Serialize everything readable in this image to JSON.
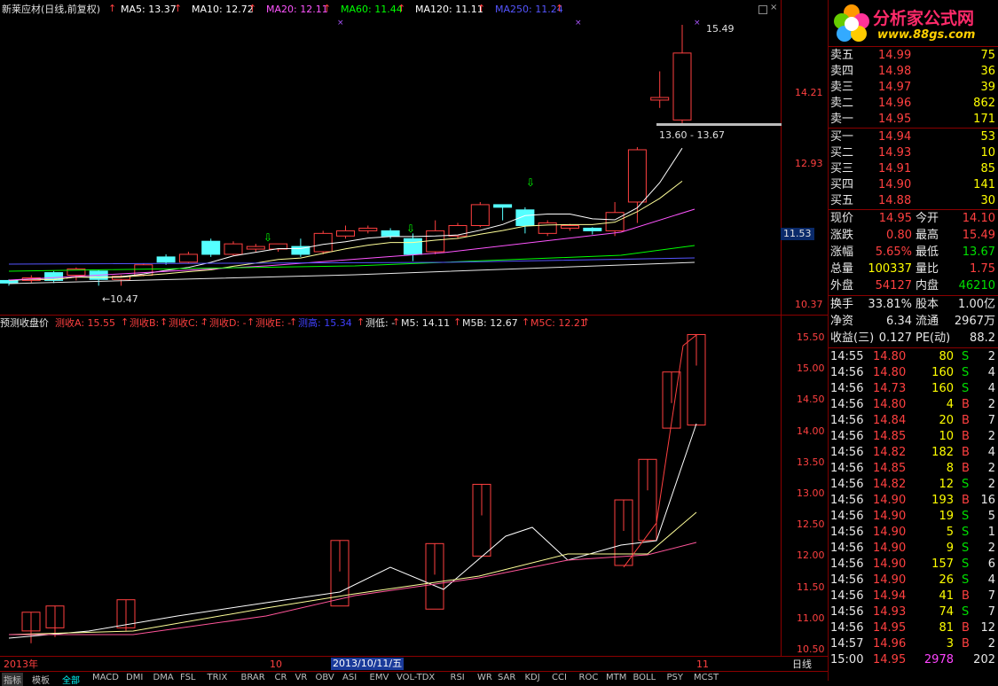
{
  "header": {
    "title": "新莱应材(日线,前复权)",
    "ma": [
      {
        "label": "MA5: 13.37",
        "color": "#ffffff"
      },
      {
        "label": "MA10: 12.72",
        "color": "#ffffff"
      },
      {
        "label": "MA20: 12.11",
        "color": "#ff55ff"
      },
      {
        "label": "MA60: 11.44",
        "color": "#00ff00"
      },
      {
        "label": "MA120: 11.11",
        "color": "#ffffff"
      },
      {
        "label": "MA250: 11.24",
        "color": "#5555ff"
      }
    ]
  },
  "upper": {
    "price_axis": [
      "14.21",
      "12.93",
      "11.53",
      "10.37"
    ],
    "current_price_box": "11.53",
    "high_label": "15.49",
    "low_label": "←10.47",
    "range_label": "13.60 - 13.67"
  },
  "lower": {
    "legend": [
      {
        "label": "预测收盘价",
        "color": "#e8e8e8"
      },
      {
        "label": "测收A: 15.55",
        "color": "#ff4040"
      },
      {
        "label": "测收B: -",
        "color": "#ff4040"
      },
      {
        "label": "测收C: -",
        "color": "#ff4040"
      },
      {
        "label": "测收D: -",
        "color": "#ff4040"
      },
      {
        "label": "测收E: -",
        "color": "#ff4040"
      },
      {
        "label": "测高: 15.34",
        "color": "#4040ff"
      },
      {
        "label": "测低: -",
        "color": "#e8e8e8"
      },
      {
        "label": "M5: 14.11",
        "color": "#e8e8e8"
      },
      {
        "label": "M5B: 12.67",
        "color": "#e8e8e8"
      },
      {
        "label": "M5C: 12.21",
        "color": "#ff4040"
      }
    ],
    "axis": [
      "15.50",
      "15.00",
      "14.50",
      "14.00",
      "13.50",
      "13.00",
      "12.50",
      "12.00",
      "11.50",
      "11.00",
      "10.50"
    ]
  },
  "date_axis": {
    "left": "2013年",
    "mid": "10",
    "selected": "2013/10/11/五",
    "right": "11",
    "period": "日线"
  },
  "bottom_tabs": [
    "指标",
    "模板",
    "全部",
    "MACD",
    "DMI",
    "DMA",
    "FSL",
    "TRIX",
    "BRAR",
    "CR",
    "VR",
    "OBV",
    "ASI",
    "EMV",
    "VOL-TDX",
    "RSI",
    "WR",
    "SAR",
    "KDJ",
    "CCI",
    "ROC",
    "MTM",
    "BOLL",
    "PSY",
    "MCST"
  ],
  "brand": {
    "name": "分析家公式网",
    "url": "www.88gs.com"
  },
  "order_book": {
    "asks": [
      {
        "label": "卖五",
        "price": "14.99",
        "vol": "75"
      },
      {
        "label": "卖四",
        "price": "14.98",
        "vol": "36"
      },
      {
        "label": "卖三",
        "price": "14.97",
        "vol": "39"
      },
      {
        "label": "卖二",
        "price": "14.96",
        "vol": "862"
      },
      {
        "label": "卖一",
        "price": "14.95",
        "vol": "171"
      }
    ],
    "bids": [
      {
        "label": "买一",
        "price": "14.94",
        "vol": "53"
      },
      {
        "label": "买二",
        "price": "14.93",
        "vol": "10"
      },
      {
        "label": "买三",
        "price": "14.91",
        "vol": "85"
      },
      {
        "label": "买四",
        "price": "14.90",
        "vol": "141"
      },
      {
        "label": "买五",
        "price": "14.88",
        "vol": "30"
      }
    ]
  },
  "quote": [
    {
      "l1": "现价",
      "v1": "14.95",
      "c1": "red",
      "l2": "今开",
      "v2": "14.10",
      "c2": "red"
    },
    {
      "l1": "涨跌",
      "v1": "0.80",
      "c1": "red",
      "l2": "最高",
      "v2": "15.49",
      "c2": "red"
    },
    {
      "l1": "涨幅",
      "v1": "5.65%",
      "c1": "red",
      "l2": "最低",
      "v2": "13.67",
      "c2": "green"
    },
    {
      "l1": "总量",
      "v1": "100337",
      "c1": "yellow",
      "l2": "量比",
      "v2": "1.75",
      "c2": "red"
    },
    {
      "l1": "外盘",
      "v1": "54127",
      "c1": "red",
      "l2": "内盘",
      "v2": "46210",
      "c2": "green"
    }
  ],
  "fundamentals": [
    {
      "l1": "换手",
      "v1": "33.81%",
      "l2": "股本",
      "v2": "1.00亿"
    },
    {
      "l1": "净资",
      "v1": "6.34",
      "l2": "流通",
      "v2": "2967万"
    },
    {
      "l1": "收益(三)",
      "v1": "0.127",
      "l2": "PE(动)",
      "v2": "88.2"
    }
  ],
  "ticks": [
    {
      "time": "14:55",
      "price": "14.80",
      "vol": "80",
      "side": "S",
      "n": "2"
    },
    {
      "time": "14:56",
      "price": "14.80",
      "vol": "160",
      "side": "S",
      "n": "4"
    },
    {
      "time": "14:56",
      "price": "14.73",
      "vol": "160",
      "side": "S",
      "n": "4"
    },
    {
      "time": "14:56",
      "price": "14.80",
      "vol": "4",
      "side": "B",
      "n": "2"
    },
    {
      "time": "14:56",
      "price": "14.84",
      "vol": "20",
      "side": "B",
      "n": "7"
    },
    {
      "time": "14:56",
      "price": "14.85",
      "vol": "10",
      "side": "B",
      "n": "2"
    },
    {
      "time": "14:56",
      "price": "14.82",
      "vol": "182",
      "side": "B",
      "n": "4"
    },
    {
      "time": "14:56",
      "price": "14.85",
      "vol": "8",
      "side": "B",
      "n": "2"
    },
    {
      "time": "14:56",
      "price": "14.82",
      "vol": "12",
      "side": "S",
      "n": "2"
    },
    {
      "time": "14:56",
      "price": "14.90",
      "vol": "193",
      "side": "B",
      "n": "16"
    },
    {
      "time": "14:56",
      "price": "14.90",
      "vol": "19",
      "side": "S",
      "n": "5"
    },
    {
      "time": "14:56",
      "price": "14.90",
      "vol": "5",
      "side": "S",
      "n": "1"
    },
    {
      "time": "14:56",
      "price": "14.90",
      "vol": "9",
      "side": "S",
      "n": "2"
    },
    {
      "time": "14:56",
      "price": "14.90",
      "vol": "157",
      "side": "S",
      "n": "6"
    },
    {
      "time": "14:56",
      "price": "14.90",
      "vol": "26",
      "side": "S",
      "n": "4"
    },
    {
      "time": "14:56",
      "price": "14.94",
      "vol": "41",
      "side": "B",
      "n": "7"
    },
    {
      "time": "14:56",
      "price": "14.93",
      "vol": "74",
      "side": "S",
      "n": "7"
    },
    {
      "time": "14:56",
      "price": "14.95",
      "vol": "81",
      "side": "B",
      "n": "12"
    },
    {
      "time": "14:57",
      "price": "14.96",
      "vol": "3",
      "side": "B",
      "n": "2"
    },
    {
      "time": "15:00",
      "price": "14.95",
      "vol": "2978",
      "side": "",
      "n": "202"
    }
  ],
  "chart_data": {
    "type": "candlestick",
    "upper_candles": [
      {
        "o": 10.55,
        "c": 10.6,
        "h": 10.62,
        "l": 10.5,
        "up": false
      },
      {
        "o": 10.6,
        "c": 10.65,
        "h": 10.7,
        "l": 10.55,
        "up": true
      },
      {
        "o": 10.75,
        "c": 10.6,
        "h": 10.78,
        "l": 10.55,
        "up": false
      },
      {
        "o": 10.7,
        "c": 10.82,
        "h": 10.85,
        "l": 10.6,
        "up": true
      },
      {
        "o": 10.78,
        "c": 10.62,
        "h": 10.8,
        "l": 10.5,
        "up": false
      },
      {
        "o": 10.62,
        "c": 10.68,
        "h": 10.7,
        "l": 10.5,
        "up": true
      },
      {
        "o": 10.7,
        "c": 10.9,
        "h": 10.93,
        "l": 10.68,
        "up": true
      },
      {
        "o": 11.05,
        "c": 10.95,
        "h": 11.1,
        "l": 10.9,
        "up": false
      },
      {
        "o": 10.95,
        "c": 11.1,
        "h": 11.15,
        "l": 10.92,
        "up": true
      },
      {
        "o": 11.35,
        "c": 11.1,
        "h": 11.4,
        "l": 11.05,
        "up": false
      },
      {
        "o": 11.1,
        "c": 11.3,
        "h": 11.35,
        "l": 11.08,
        "up": true
      },
      {
        "o": 11.2,
        "c": 11.25,
        "h": 11.3,
        "l": 11.15,
        "up": true
      },
      {
        "o": 11.2,
        "c": 11.3,
        "h": 11.3,
        "l": 11.15,
        "up": true
      },
      {
        "o": 11.25,
        "c": 11.1,
        "h": 11.4,
        "l": 11.05,
        "up": false
      },
      {
        "o": 11.15,
        "c": 11.5,
        "h": 11.55,
        "l": 11.1,
        "up": true
      },
      {
        "o": 11.45,
        "c": 11.55,
        "h": 11.65,
        "l": 11.4,
        "up": true
      },
      {
        "o": 11.55,
        "c": 11.6,
        "h": 11.65,
        "l": 11.5,
        "up": true
      },
      {
        "o": 11.55,
        "c": 11.45,
        "h": 11.6,
        "l": 11.4,
        "up": false
      },
      {
        "o": 11.4,
        "c": 11.1,
        "h": 11.5,
        "l": 10.97,
        "up": false
      },
      {
        "o": 11.15,
        "c": 11.55,
        "h": 11.75,
        "l": 11.1,
        "up": true
      },
      {
        "o": 11.45,
        "c": 11.65,
        "h": 11.7,
        "l": 11.4,
        "up": true
      },
      {
        "o": 11.65,
        "c": 12.05,
        "h": 12.1,
        "l": 11.62,
        "up": true
      },
      {
        "o": 12.05,
        "c": 12.0,
        "h": 12.05,
        "l": 11.75,
        "up": false
      },
      {
        "o": 11.65,
        "c": 11.95,
        "h": 12.0,
        "l": 11.5,
        "up": false
      },
      {
        "o": 11.5,
        "c": 11.7,
        "h": 11.75,
        "l": 11.45,
        "up": true
      },
      {
        "o": 11.6,
        "c": 11.65,
        "h": 11.68,
        "l": 11.55,
        "up": true
      },
      {
        "o": 11.55,
        "c": 11.6,
        "h": 11.62,
        "l": 11.48,
        "up": false
      },
      {
        "o": 11.55,
        "c": 11.9,
        "h": 12.1,
        "l": 11.45,
        "up": true
      },
      {
        "o": 12.1,
        "c": 13.1,
        "h": 13.15,
        "l": 11.7,
        "up": true
      },
      {
        "o": 14.05,
        "c": 14.1,
        "h": 14.6,
        "l": 13.9,
        "up": true
      },
      {
        "o": 13.67,
        "c": 14.95,
        "h": 15.49,
        "l": 13.6,
        "up": true
      }
    ]
  }
}
